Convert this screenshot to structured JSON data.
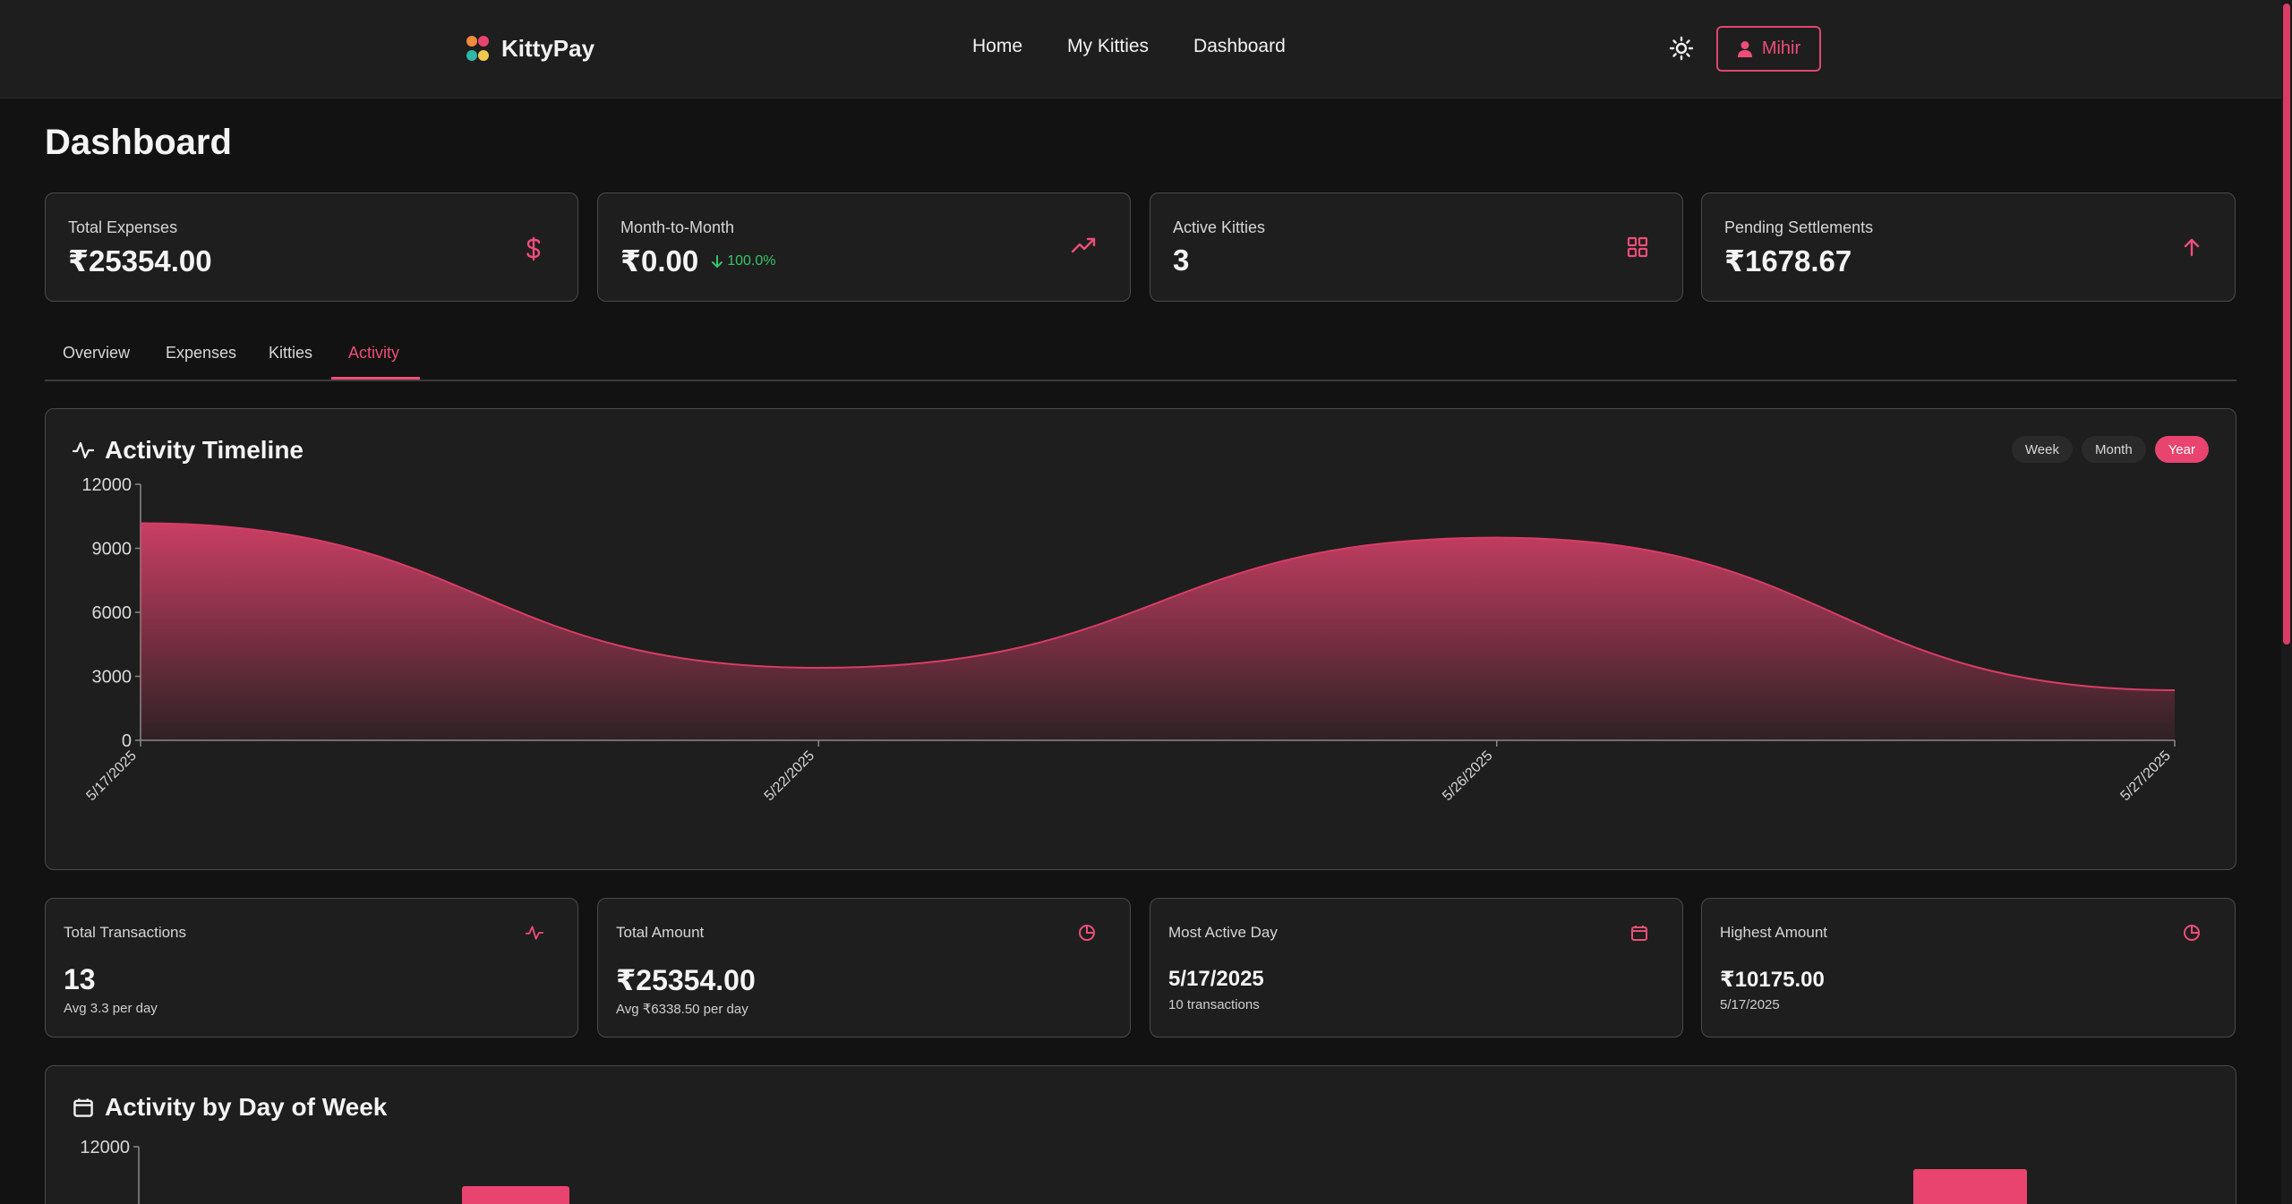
{
  "app": {
    "name": "KittyPay"
  },
  "nav": {
    "items": [
      "Home",
      "My Kitties",
      "Dashboard"
    ]
  },
  "user": {
    "name": "Mihir"
  },
  "page": {
    "title": "Dashboard"
  },
  "stats": [
    {
      "label": "Total Expenses",
      "value": "₹25354.00",
      "icon": "dollar-icon"
    },
    {
      "label": "Month-to-Month",
      "value": "₹0.00",
      "delta": "100.0%",
      "delta_direction": "down",
      "icon": "trending-up-icon"
    },
    {
      "label": "Active Kitties",
      "value": "3",
      "icon": "grid-icon"
    },
    {
      "label": "Pending Settlements",
      "value": "₹1678.67",
      "icon": "arrow-up-icon"
    }
  ],
  "tabs": [
    {
      "label": "Overview"
    },
    {
      "label": "Expenses"
    },
    {
      "label": "Kitties"
    },
    {
      "label": "Activity",
      "active": true
    }
  ],
  "timeline": {
    "title": "Activity Timeline",
    "ranges": [
      "Week",
      "Month",
      "Year"
    ],
    "active_range": "Year"
  },
  "summary": [
    {
      "label": "Total Transactions",
      "value": "13",
      "sub": "Avg 3.3 per day",
      "icon": "activity-icon"
    },
    {
      "label": "Total Amount",
      "value": "₹25354.00",
      "sub": "Avg ₹6338.50 per day",
      "icon": "pie-chart-icon"
    },
    {
      "label": "Most Active Day",
      "value": "5/17/2025",
      "sub": "10 transactions",
      "icon": "calendar-icon"
    },
    {
      "label": "Highest Amount",
      "value": "₹10175.00",
      "sub": "5/17/2025",
      "icon": "pie-chart-icon"
    }
  ],
  "weekday": {
    "title": "Activity by Day of Week"
  },
  "colors": {
    "accent": "#e8446f",
    "positive": "#35c46a",
    "background": "#121212",
    "card": "#1e1e1e"
  },
  "chart_data": [
    {
      "type": "area",
      "title": "Activity Timeline",
      "categories": [
        "5/17/2025",
        "5/22/2025",
        "5/26/2025",
        "5/27/2025"
      ],
      "values": [
        10175,
        3400,
        9500,
        2350
      ],
      "ylim": [
        0,
        12000
      ],
      "yticks": [
        0,
        3000,
        6000,
        9000,
        12000
      ],
      "grid": false,
      "legend": "none"
    },
    {
      "type": "bar",
      "title": "Activity by Day of Week",
      "ylim": [
        0,
        12000
      ],
      "yticks": [
        12000
      ],
      "note": "partially visible; only top of chart shown"
    }
  ]
}
